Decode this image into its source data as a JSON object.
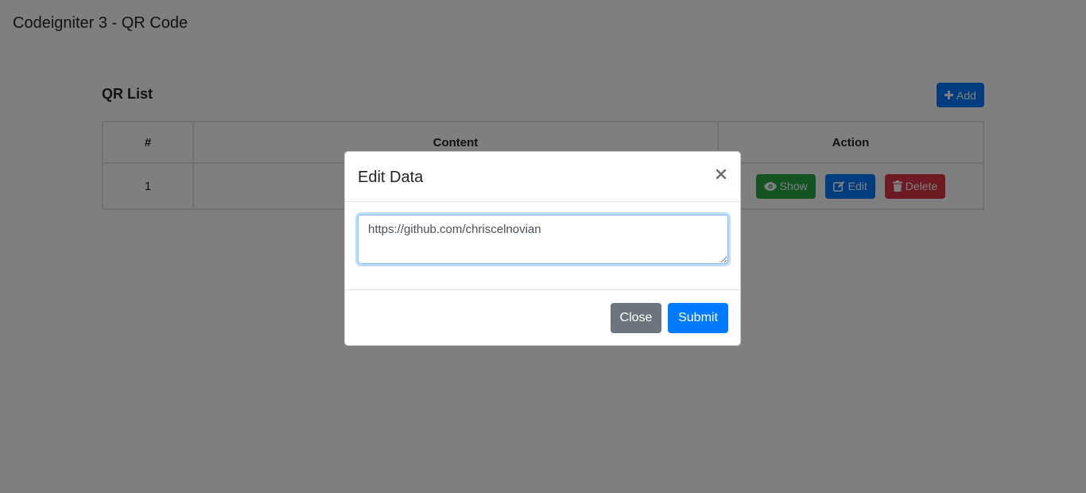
{
  "app": {
    "title": "Codeigniter 3 - QR Code"
  },
  "list": {
    "title": "QR List",
    "add_label": "Add",
    "columns": [
      "#",
      "Content",
      "Action"
    ],
    "rows": [
      {
        "num": "1",
        "content": "",
        "actions": {
          "show_label": "Show",
          "edit_label": "Edit",
          "delete_label": "Delete"
        }
      }
    ]
  },
  "modal": {
    "title": "Edit Data",
    "close_symbol": "×",
    "textarea_value": "https://github.com/chriscelnovian",
    "close_label": "Close",
    "submit_label": "Submit"
  },
  "colors": {
    "primary": "#007bff",
    "success": "#28a745",
    "danger": "#dc3545",
    "secondary": "#6c757d",
    "backdrop": "rgba(0,0,0,0.5)"
  }
}
